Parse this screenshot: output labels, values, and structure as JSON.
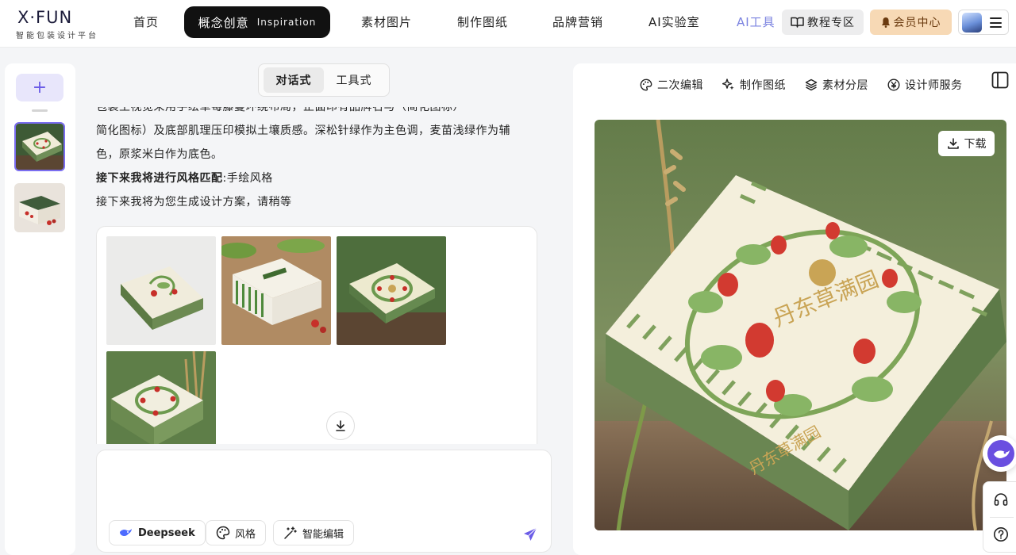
{
  "logo": {
    "main": "X·FUN",
    "sub": "智能包装设计平台"
  },
  "nav": {
    "home": "首页",
    "active_zh": "概念创意",
    "active_en": "Inspiration",
    "materials": "素材图片",
    "drawings": "制作图纸",
    "brand": "品牌营销",
    "lab": "AI实验室",
    "ai_tools": "AI工具",
    "tutorial": "教程专区",
    "vip": "会员中心"
  },
  "colors": {
    "accent": "#6b5ce7",
    "ai_tools": "#7b83e0",
    "vip_bg": "#f7d9b5",
    "nav_active_bg": "#111111",
    "send": "#6b5ce7"
  },
  "sidebar": {
    "new_label": "+",
    "thumbs": [
      "strawberry-box-preview",
      "gift-box-preview"
    ]
  },
  "chat": {
    "mode_tabs": [
      "对话式",
      "工具式"
    ],
    "line1_partial": "包装主视觉采用手绘草莓藤蔓环绕布局，正面印有品牌名与（简化图标）",
    "line2": "简化图标）及底部肌理压印模拟土壤质感。深松针绿作为主色调，麦苗浅绿作为辅",
    "line3": "色，原浆米白作为底色。",
    "line4_bold": "接下来我将进行风格匹配",
    "line4_rest": ":手绘风格",
    "line5": "接下来我将为您生成设计方案，请稍等"
  },
  "input": {
    "chips": [
      "Deepseek",
      "风格",
      "智能编辑"
    ]
  },
  "preview": {
    "tools": [
      "二次编辑",
      "制作图纸",
      "素材分层",
      "设计师服务"
    ],
    "download": "下载",
    "box_brand": "丹东草满园"
  }
}
